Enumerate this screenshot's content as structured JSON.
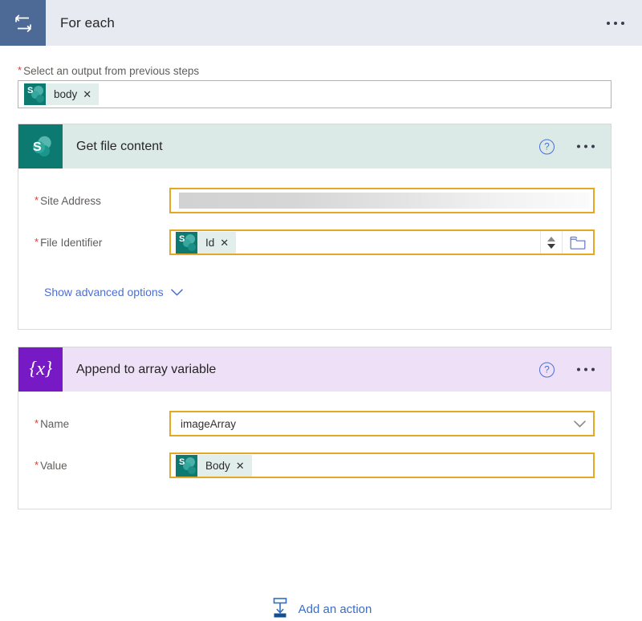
{
  "header": {
    "title": "For each",
    "icon": "loop-repeat-icon",
    "menu_icon": "ellipsis-icon",
    "bg_color": "#e7eaf1",
    "icon_bg_color": "#4d6a96"
  },
  "foreach": {
    "select_output": {
      "label": "Select an output from previous steps",
      "required": true,
      "required_marker": "*",
      "token": {
        "label": "body",
        "icon": "sharepoint-icon",
        "remove_label": "✕"
      }
    }
  },
  "cards": [
    {
      "id": "get-file-content",
      "title": "Get file content",
      "icon": "sharepoint-icon",
      "icon_bg_color": "#0d7a72",
      "header_bg_color": "#dceae7",
      "help_icon": "help-circle-icon",
      "menu_icon": "ellipsis-icon",
      "help_label": "?",
      "fields": [
        {
          "label": "Site Address",
          "required_marker": "*",
          "value_type": "redacted",
          "value": ""
        },
        {
          "label": "File Identifier",
          "required_marker": "*",
          "value_type": "token",
          "token": {
            "label": "Id",
            "icon": "sharepoint-icon",
            "remove_label": "✕"
          },
          "spinner_icon": "stepper-updown-icon",
          "picker_icon": "folder-picker-icon"
        }
      ],
      "advanced_link": {
        "label": "Show advanced options",
        "icon": "chevron-down-icon"
      }
    },
    {
      "id": "append-to-array-variable",
      "title": "Append to array variable",
      "icon": "variable-braces-icon",
      "icon_bg_color": "#7719c4",
      "header_bg_color": "#eee0f7",
      "help_icon": "help-circle-icon",
      "menu_icon": "ellipsis-icon",
      "help_label": "?",
      "fields": [
        {
          "label": "Name",
          "required_marker": "*",
          "value_type": "dropdown",
          "value": "imageArray",
          "dropdown_icon": "chevron-down-icon"
        },
        {
          "label": "Value",
          "required_marker": "*",
          "value_type": "token",
          "token": {
            "label": "Body",
            "icon": "sharepoint-icon",
            "remove_label": "✕"
          }
        }
      ]
    }
  ],
  "connector": {
    "icon": "arrow-down-icon"
  },
  "footer": {
    "add_action": {
      "label": "Add an action",
      "icon": "add-step-icon"
    }
  },
  "colors": {
    "accent_blue": "#3b6dc4",
    "field_border_orange": "#e5a823",
    "required_red": "#d93b3b",
    "sharepoint_teal": "#0d7a72",
    "variable_purple": "#7719c4"
  }
}
